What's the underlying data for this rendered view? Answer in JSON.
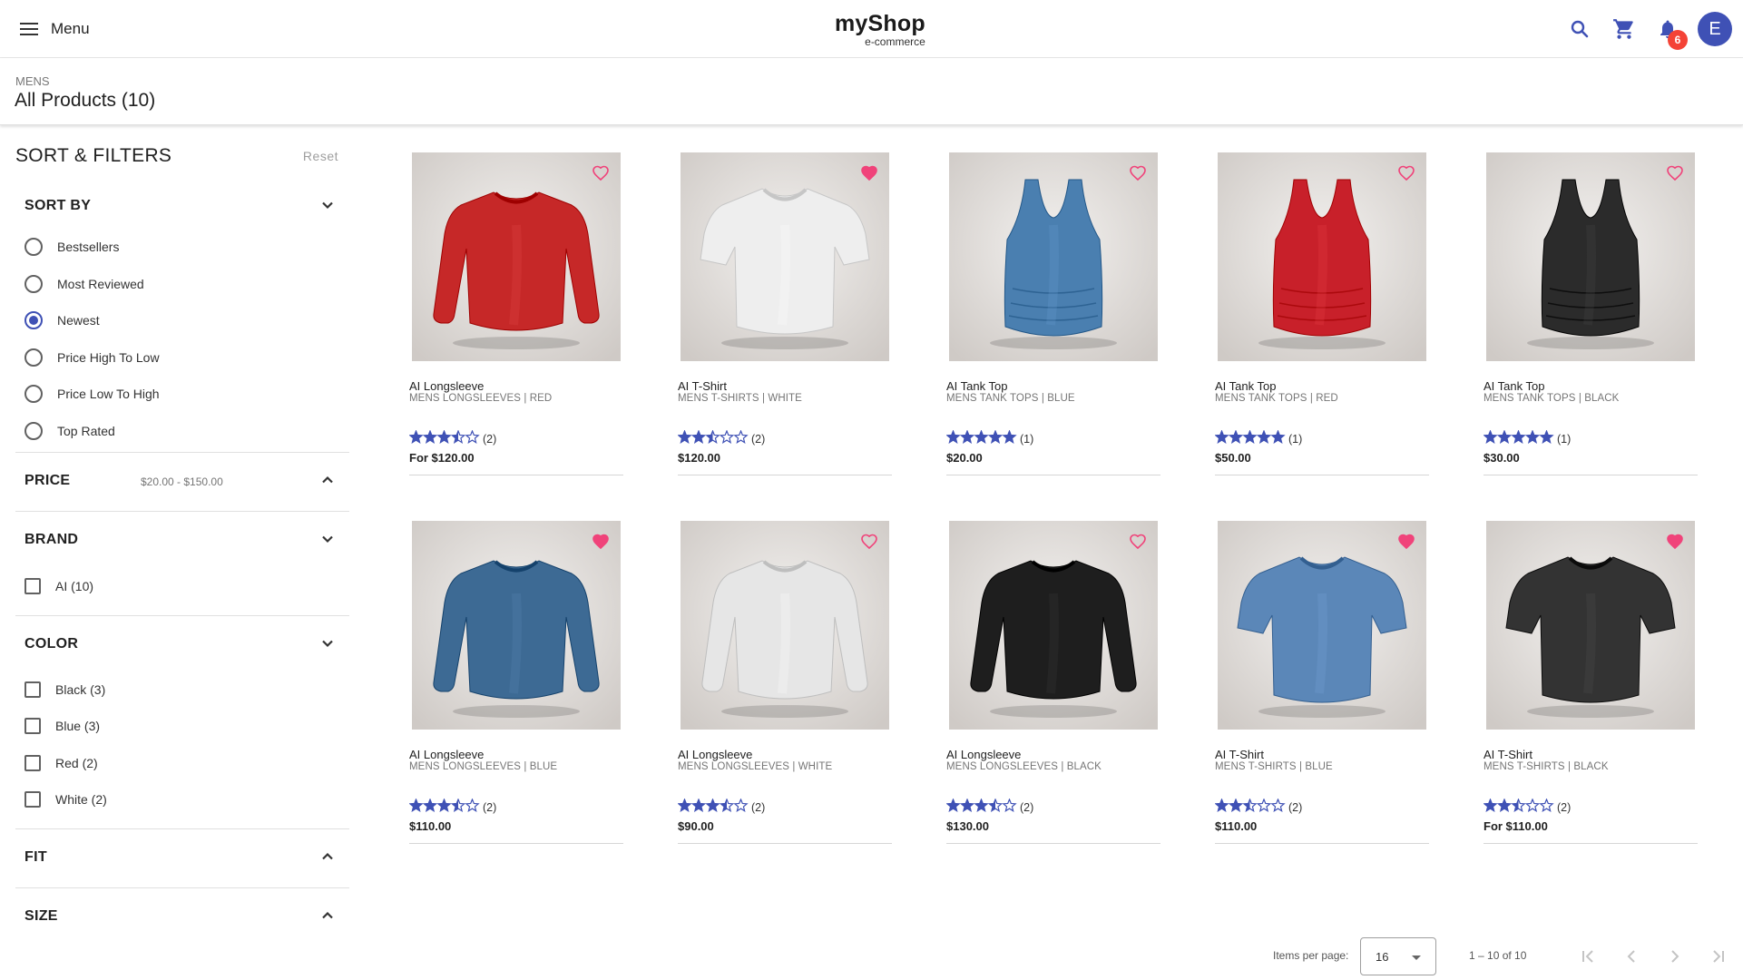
{
  "header": {
    "menu_label": "Menu",
    "logo_name": "myShop",
    "logo_sub": "e-commerce",
    "notification_count": "6",
    "avatar_initial": "E",
    "accent": "#3f51b5",
    "badge_color": "#f44336"
  },
  "page": {
    "breadcrumb": "MENS",
    "title": "All Products (10)"
  },
  "filters": {
    "title": "SORT & FILTERS",
    "reset": "Reset",
    "sort": {
      "label": "SORT BY",
      "options": [
        "Bestsellers",
        "Most Reviewed",
        "Newest",
        "Price High To Low",
        "Price Low To High",
        "Top Rated"
      ],
      "selected": "Newest"
    },
    "price": {
      "label": "PRICE",
      "range": "$20.00 - $150.00"
    },
    "brand": {
      "label": "BRAND",
      "options": [
        "AI (10)"
      ]
    },
    "color": {
      "label": "COLOR",
      "options": [
        "Black (3)",
        "Blue (3)",
        "Red (2)",
        "White (2)"
      ]
    },
    "fit": {
      "label": "FIT"
    },
    "size": {
      "label": "SIZE"
    }
  },
  "products": [
    {
      "name": "AI Longsleeve",
      "meta": "MENS LONGSLEEVES | RED",
      "rating": 3.5,
      "reviews": "(2)",
      "price": "For $120.00",
      "favorited": false,
      "garment": "longsleeve",
      "color": "#c62828"
    },
    {
      "name": "AI T-Shirt",
      "meta": "MENS T-SHIRTS | WHITE",
      "rating": 2.5,
      "reviews": "(2)",
      "price": "$120.00",
      "favorited": true,
      "garment": "tshirt",
      "color": "#eeeeee"
    },
    {
      "name": "AI Tank Top",
      "meta": "MENS TANK TOPS | BLUE",
      "rating": 5,
      "reviews": "(1)",
      "price": "$20.00",
      "favorited": false,
      "garment": "tank",
      "color": "#4a7fb0"
    },
    {
      "name": "AI Tank Top",
      "meta": "MENS TANK TOPS | RED",
      "rating": 5,
      "reviews": "(1)",
      "price": "$50.00",
      "favorited": false,
      "garment": "tank",
      "color": "#c8202a"
    },
    {
      "name": "AI Tank Top",
      "meta": "MENS TANK TOPS | BLACK",
      "rating": 5,
      "reviews": "(1)",
      "price": "$30.00",
      "favorited": false,
      "garment": "tank",
      "color": "#2b2b2b"
    },
    {
      "name": "AI Longsleeve",
      "meta": "MENS LONGSLEEVES | BLUE",
      "rating": 3.5,
      "reviews": "(2)",
      "price": "$110.00",
      "favorited": true,
      "garment": "longsleeve",
      "color": "#3d6a94"
    },
    {
      "name": "AI Longsleeve",
      "meta": "MENS LONGSLEEVES | WHITE",
      "rating": 3.5,
      "reviews": "(2)",
      "price": "$90.00",
      "favorited": false,
      "garment": "longsleeve",
      "color": "#e6e6e6"
    },
    {
      "name": "AI Longsleeve",
      "meta": "MENS LONGSLEEVES | BLACK",
      "rating": 3.5,
      "reviews": "(2)",
      "price": "$130.00",
      "favorited": false,
      "garment": "longsleeve",
      "color": "#1e1e1e"
    },
    {
      "name": "AI T-Shirt",
      "meta": "MENS T-SHIRTS | BLUE",
      "rating": 2.5,
      "reviews": "(2)",
      "price": "$110.00",
      "favorited": true,
      "garment": "tshirt",
      "color": "#5b87b8"
    },
    {
      "name": "AI T-Shirt",
      "meta": "MENS T-SHIRTS | BLACK",
      "rating": 2.5,
      "reviews": "(2)",
      "price": "For $110.00",
      "favorited": true,
      "garment": "tshirt",
      "color": "#333333"
    }
  ],
  "pagination": {
    "items_per_page_label": "Items per page:",
    "items_per_page": "16",
    "range": "1 – 10 of 10"
  },
  "colors": {
    "favorite": "#f0437a",
    "star": "#3f51b5"
  }
}
